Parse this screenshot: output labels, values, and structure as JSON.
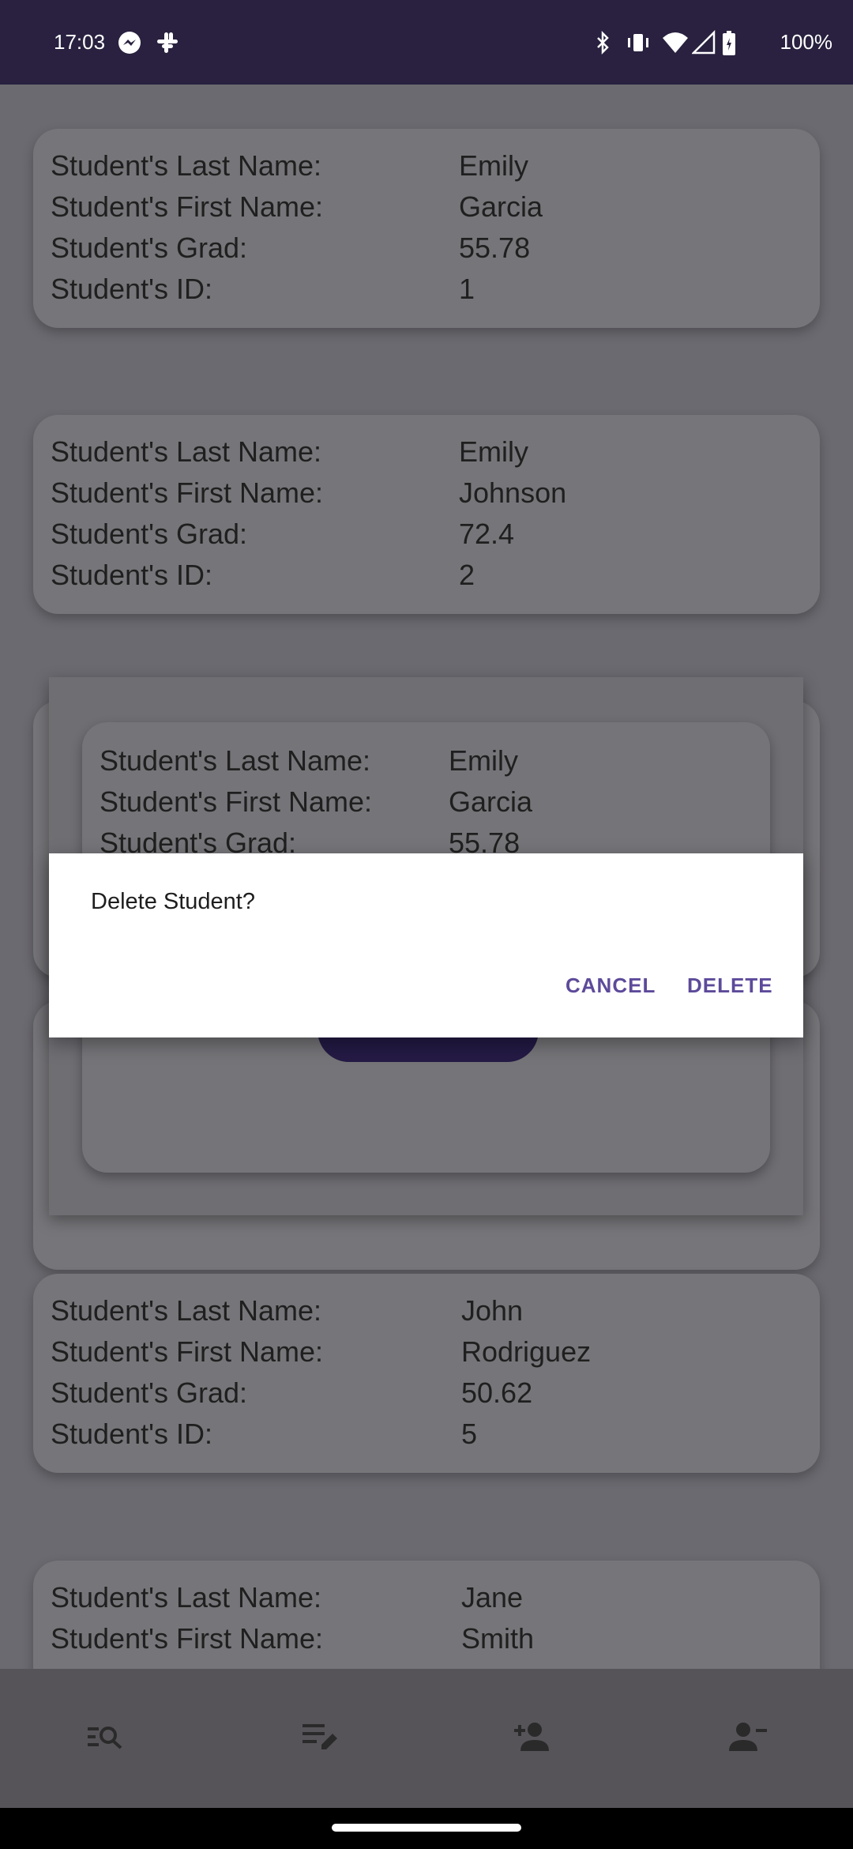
{
  "status_bar": {
    "time": "17:03",
    "battery": "100%",
    "left_icons": [
      "messenger-icon",
      "slack-icon"
    ],
    "right_icons": [
      "bluetooth-icon",
      "vibrate-icon",
      "wifi-icon",
      "signal-icon",
      "battery-icon"
    ]
  },
  "labels": {
    "last_name": "Student's Last Name:",
    "first_name": "Student's First Name:",
    "grad": "Student's Grad:",
    "id": "Student's ID:"
  },
  "students": [
    {
      "last": "Emily",
      "first": "Garcia",
      "grad": "55.78",
      "id": "1"
    },
    {
      "last": "Emily",
      "first": "Johnson",
      "grad": "72.4",
      "id": "2"
    },
    {
      "last": "John",
      "first": "Rodriguez",
      "grad": "50.62",
      "id": "5"
    },
    {
      "last": "Jane",
      "first": "Smith"
    }
  ],
  "popup": {
    "last_label": "Student's Last Name:",
    "last": "Emily",
    "first_label": "Student's First Name:",
    "first": "Garcia",
    "grad_label": "Student's Grad:",
    "grad": "55.78"
  },
  "dialog": {
    "title": "Delete Student?",
    "cancel": "CANCEL",
    "delete": "DELETE"
  },
  "bottom_nav": [
    "search-list-icon",
    "edit-list-icon",
    "add-person-icon",
    "remove-person-icon"
  ],
  "colors": {
    "status_bar": "#29213f",
    "accent": "#5d4a9a",
    "scrim_bg": "#6b6a70"
  }
}
